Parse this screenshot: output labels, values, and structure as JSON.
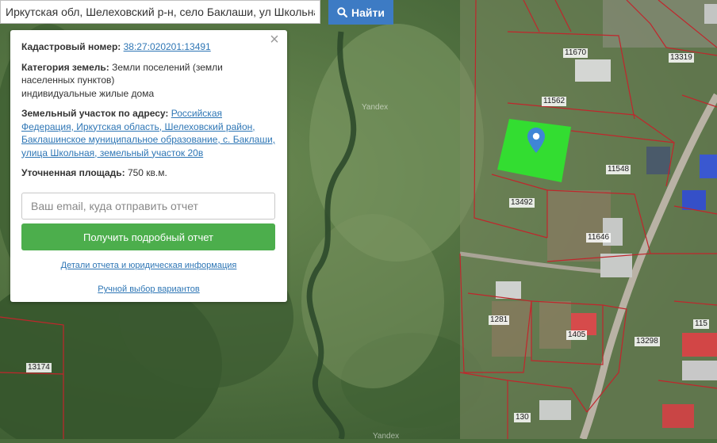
{
  "search": {
    "value": "Иркутская обл, Шелеховский р-н, село Баклаши, ул Школьная",
    "button_label": "Найти",
    "button_icon": "search-icon"
  },
  "panel": {
    "cadastral_label": "Кадастровый номер:",
    "cadastral_value": "38:27:020201:13491",
    "category_label": "Категория земель:",
    "category_value": "Земли поселений (земли населенных пунктов)",
    "category_use": "индивидуальные жилые дома",
    "address_label": "Земельный участок по адресу:",
    "address_value": "Российская Федерация, Иркутская область, Шелеховский район, Баклашинское муниципальное образование, с. Баклаши, улица Школьная, земельный участок 20в",
    "area_label": "Уточненная площадь:",
    "area_value": "750 кв.м.",
    "email_placeholder": "Ваш email, куда отправить отчет",
    "report_button": "Получить подробный отчет",
    "details_link": "Детали отчета и юридическая информация",
    "manual_link": "Ручной выбор вариантов",
    "close_icon": "close-icon"
  },
  "map": {
    "watermark": "Yandex",
    "marker_icon": "map-pin-icon",
    "highlight_color": "#2ee82e",
    "parcel_line_color": "#c0262c",
    "parcel_labels": [
      "11670",
      "13319",
      "11562",
      "11548",
      "13492",
      "11646",
      "1281",
      "1405",
      "13298",
      "115",
      "13174",
      "130"
    ]
  }
}
